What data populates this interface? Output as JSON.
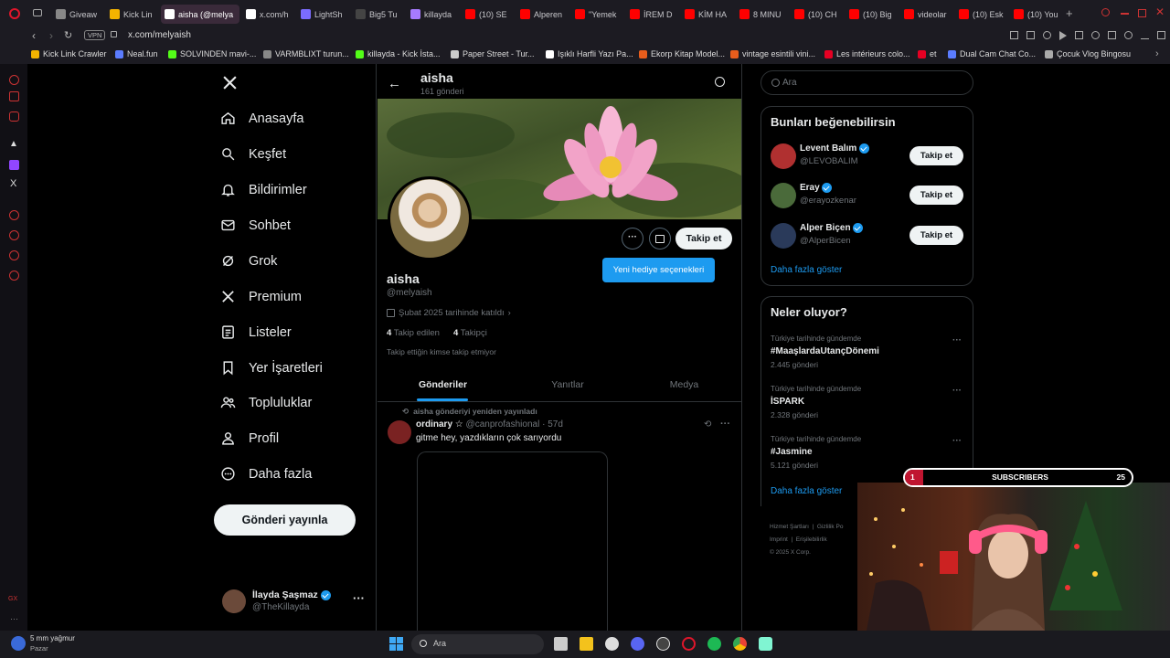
{
  "browser": {
    "tabs": [
      {
        "label": "Giveaw",
        "color": "#888"
      },
      {
        "label": "Kick Lin",
        "color": "#f5b400"
      },
      {
        "label": "aisha (@melya",
        "color": "#ffffff"
      },
      {
        "label": "x.com/h",
        "color": "#ffffff"
      },
      {
        "label": "LightSh",
        "color": "#7b6cff"
      },
      {
        "label": "Big5 Tu",
        "color": "#444"
      },
      {
        "label": "killayda",
        "color": "#a77bff"
      },
      {
        "label": "(10) SE",
        "color": "#ff0000"
      },
      {
        "label": "Alperen",
        "color": "#ff0000"
      },
      {
        "label": "\"Yemek",
        "color": "#ff0000"
      },
      {
        "label": "İREM D",
        "color": "#ff0000"
      },
      {
        "label": "KİM HA",
        "color": "#ff0000"
      },
      {
        "label": "8 MINU",
        "color": "#ff0000"
      },
      {
        "label": "(10) CH",
        "color": "#ff0000"
      },
      {
        "label": "(10) Big",
        "color": "#ff0000"
      },
      {
        "label": "videolar",
        "color": "#ff0000"
      },
      {
        "label": "(10) Esk",
        "color": "#ff0000"
      },
      {
        "label": "(10) You",
        "color": "#ff0000"
      }
    ],
    "vpn": "VPN",
    "url": "x.com/melyaish",
    "bookmarks": [
      {
        "label": "Kick Link Crawler",
        "color": "#f5b400"
      },
      {
        "label": "Neal.fun",
        "color": "#5b7cff"
      },
      {
        "label": "SOLVINDEN mavi-...",
        "color": "#53fc18"
      },
      {
        "label": "VARMBLIXT turun...",
        "color": "#888"
      },
      {
        "label": "killayda - Kick İsta...",
        "color": "#53fc18"
      },
      {
        "label": "Paper Street - Tur...",
        "color": "#ccc"
      },
      {
        "label": "Işıklı Harfli Yazı Pa...",
        "color": "#fff"
      },
      {
        "label": "Ekorp Kitap Model...",
        "color": "#e85d1c"
      },
      {
        "label": "vintage esintili vini...",
        "color": "#e85d1c"
      },
      {
        "label": "Les intérieurs colo...",
        "color": "#e60023"
      },
      {
        "label": "et",
        "color": "#e60023"
      },
      {
        "label": "Dual Cam Chat Co...",
        "color": "#5b7cff"
      },
      {
        "label": "Çocuk Vlog Bingosu",
        "color": "#aaa"
      }
    ]
  },
  "sidebar": {
    "items": [
      {
        "label": "Anasayfa",
        "icon": "home-icon"
      },
      {
        "label": "Keşfet",
        "icon": "search-icon"
      },
      {
        "label": "Bildirimler",
        "icon": "bell-icon"
      },
      {
        "label": "Sohbet",
        "icon": "mail-icon"
      },
      {
        "label": "Grok",
        "icon": "grok-icon"
      },
      {
        "label": "Premium",
        "icon": "x-logo-icon"
      },
      {
        "label": "Listeler",
        "icon": "list-icon"
      },
      {
        "label": "Yer İşaretleri",
        "icon": "bookmark-icon"
      },
      {
        "label": "Topluluklar",
        "icon": "people-icon"
      },
      {
        "label": "Profil",
        "icon": "person-icon"
      },
      {
        "label": "Daha fazla",
        "icon": "more-circle-icon"
      }
    ],
    "post_button": "Gönderi yayınla",
    "account": {
      "name": "İlayda Şaşmaz",
      "handle": "@TheKillayda"
    }
  },
  "profile": {
    "header_name": "aisha",
    "post_count": "161 gönderi",
    "name": "aisha",
    "handle": "@melyaish",
    "joined": "Şubat 2025 tarihinde katıldı",
    "following_count": "4",
    "following_label": "Takip edilen",
    "followers_count": "4",
    "followers_label": "Takipçi",
    "follow_note": "Takip ettiğin kimse takip etmiyor",
    "follow_button": "Takip et",
    "gift_tooltip": "Yeni hediye seçenekleri",
    "tabs": [
      "Gönderiler",
      "Yanıtlar",
      "Medya"
    ],
    "repost_note": "aisha gönderiyi yeniden yayınladı",
    "post": {
      "author": "ordinary ☆",
      "handle": "@canprofashional",
      "time": "· 57d",
      "text": "gitme hey, yazdıkların çok sarıyordu"
    }
  },
  "right": {
    "search_placeholder": "Ara",
    "who_to_follow_title": "Bunları beğenebilirsin",
    "suggestions": [
      {
        "name": "Levent Balım",
        "handle": "@LEVOBALIM",
        "button": "Takip et",
        "color": "#b03030"
      },
      {
        "name": "Eray",
        "handle": "@erayozkenar",
        "button": "Takip et",
        "color": "#4a6a3a"
      },
      {
        "name": "Alper Biçen",
        "handle": "@AlperBicen",
        "button": "Takip et",
        "color": "#2a3a5a"
      }
    ],
    "show_more": "Daha fazla göster",
    "trends_title": "Neler oluyor?",
    "trends": [
      {
        "context": "Türkiye tarihinde gündemde",
        "name": "#MaaşlardaUtançDönemi",
        "count": "2.445 gönderi"
      },
      {
        "context": "Türkiye tarihinde gündemde",
        "name": "İSPARK",
        "count": "2.328 gönderi"
      },
      {
        "context": "Türkiye tarihinde gündemde",
        "name": "#Jasmine",
        "count": "5.121 gönderi"
      }
    ],
    "trends_show_more": "Daha fazla göster",
    "footer": [
      "Hizmet Şartları",
      "Gizlilik Po",
      "Imprint",
      "Erişilebilirlik",
      "© 2025 X Corp."
    ]
  },
  "overlay": {
    "subscribers_label": "SUBSCRIBERS",
    "subscribers_left": "1",
    "subscribers_right": "25"
  },
  "taskbar": {
    "weather": "5 mm yağmur",
    "day": "Pazar",
    "search": "Ara"
  }
}
